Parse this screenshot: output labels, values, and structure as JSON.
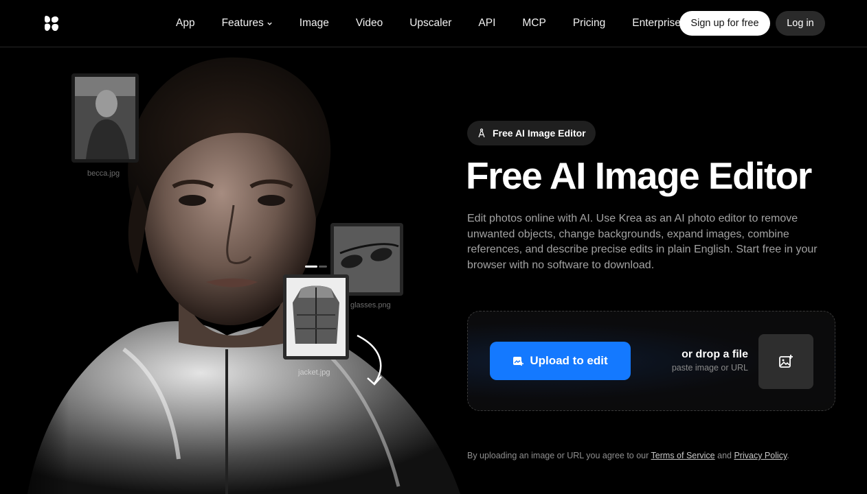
{
  "nav": {
    "links": [
      {
        "label": "App"
      },
      {
        "label": "Features",
        "has_dropdown": true
      },
      {
        "label": "Image"
      },
      {
        "label": "Video"
      },
      {
        "label": "Upscaler"
      },
      {
        "label": "API"
      },
      {
        "label": "MCP"
      },
      {
        "label": "Pricing"
      },
      {
        "label": "Enterprise"
      }
    ],
    "signup_label": "Sign up for free",
    "login_label": "Log in"
  },
  "hero": {
    "thumbnails": [
      {
        "label": "becca.jpg"
      },
      {
        "label": "glasses.png"
      },
      {
        "label": "jacket.jpg"
      }
    ]
  },
  "badge": {
    "label": "Free AI Image Editor",
    "icon": "compass-icon"
  },
  "headline": "Free AI Image Editor",
  "description": "Edit photos online with AI. Use Krea as an AI photo editor to remove unwanted objects, change backgrounds, expand images, combine references, and describe precise edits in plain English. Start free in your browser with no software to download.",
  "upload": {
    "button_label": "Upload to edit",
    "drop_title": "or drop a file",
    "drop_subtitle": "paste image or URL"
  },
  "terms": {
    "prefix": "By uploading an image or URL you agree to our",
    "tos": "Terms of Service",
    "and": "and",
    "privacy": "Privacy Policy",
    "suffix": "."
  },
  "colors": {
    "accent": "#1479ff",
    "background": "#000000",
    "muted_text": "#a3a3a3"
  }
}
